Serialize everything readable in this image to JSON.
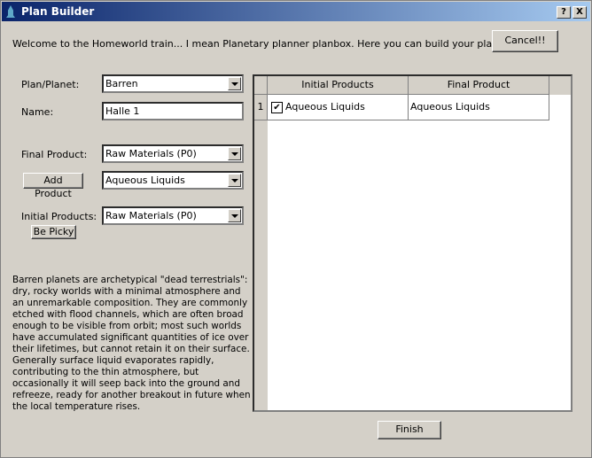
{
  "window": {
    "title": "Plan Builder",
    "help_label": "?",
    "close_label": "X"
  },
  "welcome": "Welcome to the Homeworld train... I mean Planetary planner planbox. Here you can build your plan.",
  "cancel_label": "Cancel!!",
  "form": {
    "plan_planet_label": "Plan/Planet:",
    "plan_planet_value": "Barren",
    "name_label": "Name:",
    "name_value": "Halle 1",
    "final_product_label": "Final Product:",
    "final_product_tier": "Raw Materials (P0)",
    "add_product_label": "Add Product",
    "final_product_value": "Aqueous Liquids",
    "initial_products_label": "Initial Products:",
    "initial_products_tier": "Raw Materials (P0)",
    "be_picky_label": "Be Picky"
  },
  "description": "Barren planets are archetypical \"dead terrestrials\": dry, rocky worlds with a minimal atmosphere and an unremarkable composition. They are commonly etched with flood channels, which are often broad enough to be visible from orbit; most such worlds have accumulated significant quantities of ice over their lifetimes, but cannot retain it on their surface. Generally surface liquid evaporates rapidly, contributing to the thin atmosphere, but occasionally it will seep back into the ground and refreeze, ready for another breakout in future when the local temperature rises.",
  "table": {
    "headers": [
      "Initial Products",
      "Final Product"
    ],
    "rows": [
      {
        "num": "1",
        "checked": true,
        "initial": "Aqueous Liquids",
        "final": "Aqueous Liquids"
      }
    ]
  },
  "finish_label": "Finish"
}
